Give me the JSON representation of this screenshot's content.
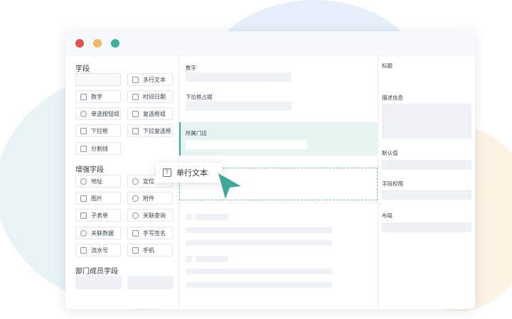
{
  "left_panel": {
    "fields_title": "字段",
    "fields": [
      {
        "label": "",
        "icon": "empty-placeholder"
      },
      {
        "label": "多行文本",
        "icon": "multiline-text-icon"
      },
      {
        "label": "数字",
        "icon": "number-icon"
      },
      {
        "label": "时间日期",
        "icon": "calendar-icon"
      },
      {
        "label": "单选按钮组",
        "icon": "radio-icon"
      },
      {
        "label": "复选框组",
        "icon": "checkbox-icon"
      },
      {
        "label": "下拉框",
        "icon": "dropdown-icon"
      },
      {
        "label": "下拉复选框",
        "icon": "dropdown-multi-icon"
      },
      {
        "label": "分割线",
        "icon": "divider-icon"
      }
    ],
    "enhanced_title": "增强字段",
    "enhanced_fields": [
      {
        "label": "地址",
        "icon": "location-pin-icon"
      },
      {
        "label": "定位",
        "icon": "target-icon"
      },
      {
        "label": "图片",
        "icon": "image-icon"
      },
      {
        "label": "附件",
        "icon": "cloud-upload-icon"
      },
      {
        "label": "子表单",
        "icon": "subform-icon"
      },
      {
        "label": "关联查询",
        "icon": "link-query-icon"
      },
      {
        "label": "关联数据",
        "icon": "link-data-icon"
      },
      {
        "label": "手写签名",
        "icon": "pen-icon"
      },
      {
        "label": "流水号",
        "icon": "serial-number-icon"
      },
      {
        "label": "手机",
        "icon": "phone-icon"
      }
    ],
    "dept_title": "部门成员字段"
  },
  "form_canvas": {
    "fields": [
      {
        "label": "数字"
      },
      {
        "label": "下拉框占据"
      },
      {
        "label": "所属门店"
      }
    ]
  },
  "drag_chip": {
    "label": "单行文本",
    "icon": "text-icon"
  },
  "properties": {
    "title_label": "标题",
    "description_label": "描述信息",
    "default_label": "默认值",
    "permission_label": "字段权限",
    "layout_label": "布局"
  },
  "colors": {
    "accent": "#3fa79a",
    "window_dots": [
      "#dc5650",
      "#f2b765",
      "#3fae9a"
    ]
  }
}
